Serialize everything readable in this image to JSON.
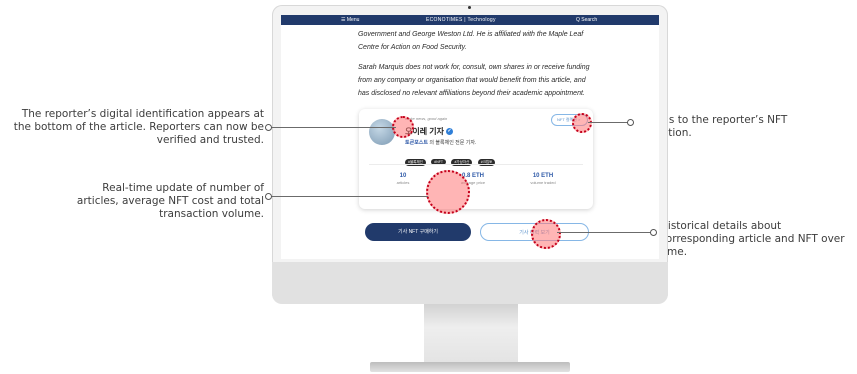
{
  "callouts": {
    "identification": "The reporter’s digital identification appears at the bottom of the article. Reporters can now be verified and trusted.",
    "realtime": "Real-time update of number of articles, average NFT cost and total transaction volume.",
    "nft_collection": "Details to the reporter’s NFT collection.",
    "history": "Historical details about corresponding article and NFT over time."
  },
  "site": {
    "menu_label": "☰ Menu",
    "brand": "ECONOTIMES | Technology",
    "search_label": "Q Search"
  },
  "article": {
    "para1": "Government and George Weston Ltd. He is affiliated with the Maple Leaf Centre for Action on Food Security.",
    "para2": "Sarah Marquis does not work for, consult, own shares in or receive funding from any company or organisation that would benefit from this article, and has disclosed no relevant affiliations beyond their academic appointment."
  },
  "reporter": {
    "eyebrow": "make news, good again",
    "name": "오이레 기자",
    "verified_mark": "✓",
    "desc_outlet": "토큰포스트",
    "desc_rest": " 의 블록체인 전문 기자.",
    "tags": [
      "#블록체인",
      "#NFT",
      "#가상자산",
      "#크립토"
    ],
    "nft_button": "NFT 컬렉션 >"
  },
  "stats": [
    {
      "value": "10",
      "label": "articles"
    },
    {
      "value": "0.8 ETH",
      "label": "average price"
    },
    {
      "value": "10 ETH",
      "label": "volume traded"
    }
  ],
  "buttons": {
    "buy": "기사 NFT 구매하기",
    "history": "기사 이력 보기"
  }
}
